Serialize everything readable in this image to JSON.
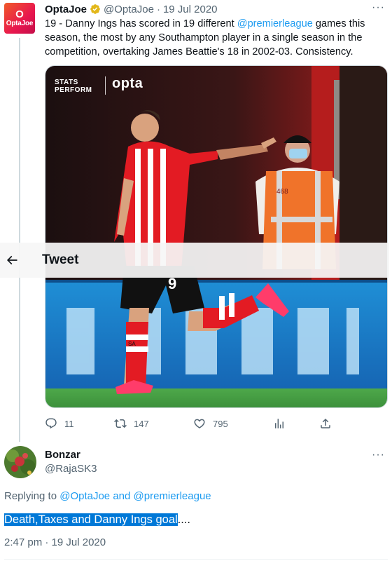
{
  "tweet": {
    "avatar_text": "OptaJoe",
    "author_name": "OptaJoe",
    "author_handle": "@OptaJoe",
    "separator": "·",
    "date": "19 Jul 2020",
    "more_label": "···",
    "text_before_link": "19 - Danny Ings has scored in 19 different ",
    "mention": "@premierleague",
    "text_after_link": " games this season, the most by any Southampton player in a single season in the competition, overtaking James Beattie's 18 in 2002-03. Consistency.",
    "media": {
      "brand_line1": "STATS",
      "brand_line2": "PERFORM",
      "brand_opta": "opta",
      "shirt_number": "9",
      "steward_number": "468",
      "sock_text": "SA"
    },
    "actions": {
      "reply_count": "11",
      "retweet_count": "147",
      "like_count": "795"
    }
  },
  "header": {
    "title": "Tweet"
  },
  "reply": {
    "author_name": "Bonzar",
    "author_handle": "@RajaSK3",
    "more_label": "···",
    "replying_prefix": "Replying to ",
    "replying_to_1": "@OptaJoe",
    "replying_and": " and ",
    "replying_to_2": "@premierleague",
    "body_selected": "Death,Taxes and Danny Ings goal",
    "body_rest": "....",
    "timestamp": "2:47 pm · 19 Jul 2020"
  },
  "colors": {
    "link": "#1d9bf0",
    "muted": "#536471",
    "selection": "#0078d7",
    "verified": "#e2b719"
  }
}
